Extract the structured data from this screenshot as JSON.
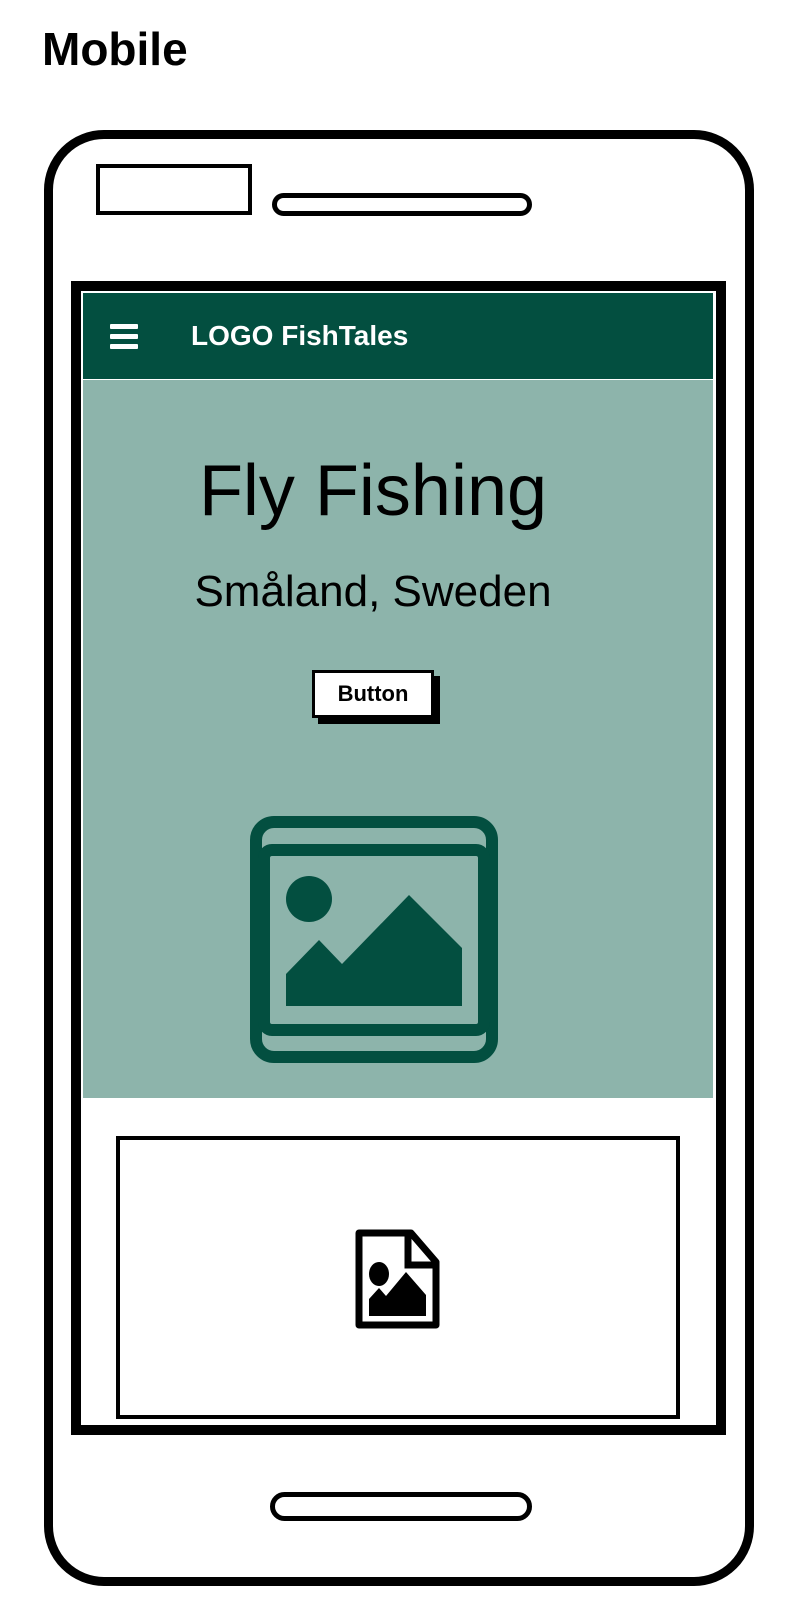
{
  "frame_label": "Mobile",
  "header": {
    "menu_icon": "hamburger-icon",
    "brand": "LOGO FishTales"
  },
  "hero": {
    "title": "Fly Fishing",
    "subtitle": "Småland, Sweden",
    "button_label": "Button",
    "image_icon": "image-placeholder-icon"
  },
  "card": {
    "icon": "image-file-icon"
  },
  "colors": {
    "header_bg": "#034f40",
    "hero_bg": "#8db4ab",
    "accent": "#034f40"
  }
}
